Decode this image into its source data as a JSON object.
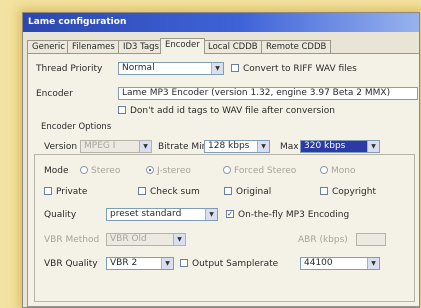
{
  "window": {
    "title": "Lame configuration"
  },
  "tabs": [
    "Generic",
    "Filenames",
    "ID3 Tags",
    "Encoder",
    "Local CDDB",
    "Remote CDDB"
  ],
  "active_tab": "Encoder",
  "thread_priority": {
    "label": "Thread Priority",
    "value": "Normal"
  },
  "convert_riff": {
    "label": "Convert to RIFF WAV files",
    "checked": false
  },
  "encoder": {
    "label": "Encoder",
    "value": "Lame MP3 Encoder (version 1.32, engine 3.97 Beta 2 MMX)",
    "hidden_opt_label": "Don't add id tags to WAV file after conversion",
    "hidden_opt_checked": false
  },
  "options": {
    "group_label": "Encoder Options",
    "version": {
      "label": "Version",
      "value": "MPEG I"
    },
    "bitrate_min": {
      "label": "Bitrate Min",
      "value": "128 kbps"
    },
    "bitrate_max": {
      "label": "Max",
      "value": "320 kbps"
    },
    "mode": {
      "label": "Mode",
      "items": [
        "Stereo",
        "J-stereo",
        "Forced Stereo",
        "Mono"
      ],
      "selected": "J-stereo"
    },
    "flags": [
      {
        "label": "Private",
        "checked": false
      },
      {
        "label": "Check sum",
        "checked": false
      },
      {
        "label": "Original",
        "checked": false
      },
      {
        "label": "Copyright",
        "checked": false
      }
    ],
    "quality": {
      "label": "Quality",
      "value": "preset standard"
    },
    "on_the_fly": {
      "label": "On-the-fly MP3 Encoding",
      "checked": true
    },
    "vbr_method": {
      "label": "VBR Method",
      "value": "VBR Old"
    },
    "abr": {
      "label": "ABR (kbps)",
      "value": ""
    },
    "vbr_quality": {
      "label": "VBR Quality",
      "value": "VBR 2"
    },
    "output_samplerate": {
      "label": "Output Samplerate",
      "value": "44100"
    }
  },
  "colors": {
    "title_start": "#2d47b0",
    "title_end": "#98b2ee",
    "accent": "#2c3aa8",
    "backdrop": "#f3e3a2"
  }
}
